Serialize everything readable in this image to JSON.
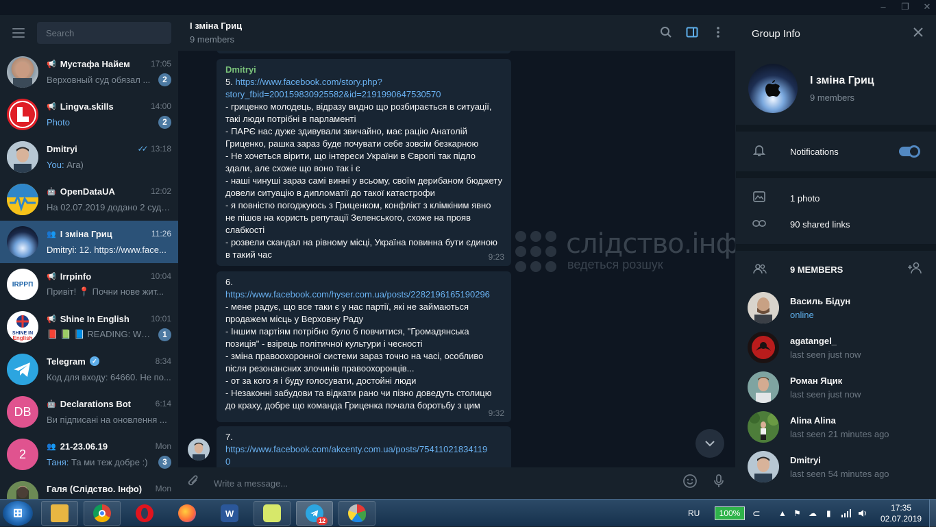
{
  "window": {
    "controls": [
      "–",
      "❐",
      "✕"
    ]
  },
  "sidebar": {
    "search_placeholder": "Search",
    "chats": [
      {
        "name": "Мустафа Найем",
        "time": "17:05",
        "preview": "Верховный суд обязал ...",
        "badge": "2",
        "type": "channel"
      },
      {
        "name": "Lingva.skills",
        "time": "14:00",
        "preview": "Photo",
        "badge": "2",
        "type": "channel"
      },
      {
        "name": "Dmitryi",
        "time": "13:18",
        "sender": "You:",
        "preview": "Ага)",
        "read": true
      },
      {
        "name": "OpenDataUA",
        "time": "12:02",
        "preview": "На 02.07.2019 додано 2 судо...",
        "type": "bot"
      },
      {
        "name": "І зміна Гриц",
        "time": "11:26",
        "sender": "Dmitryi:",
        "preview": "12. https://www.face...",
        "type": "group",
        "active": true
      },
      {
        "name": "Irrpinfo",
        "time": "10:04",
        "preview": "Привіт! 📍 Почни нове жит...",
        "type": "channel"
      },
      {
        "name": "Shine In English",
        "time": "10:01",
        "preview": "📕 📗 📘 READING: WO...",
        "badge": "1",
        "type": "channel"
      },
      {
        "name": "Telegram",
        "time": "8:34",
        "preview": "Код для входу: 64660. Не по...",
        "verified": true
      },
      {
        "name": "Declarations Bot",
        "time": "6:14",
        "preview": "Ви підписані на оновлення ...",
        "type": "bot",
        "initials": "DB"
      },
      {
        "name": "21-23.06.19",
        "time": "Mon",
        "sender": "Таня:",
        "preview": "Та ми теж добре :)",
        "badge": "3",
        "type": "group",
        "initials": "2"
      },
      {
        "name": "Галя (Слідство. Інфо)",
        "time": "Mon",
        "preview": ""
      }
    ]
  },
  "chat": {
    "title": "І зміна Гриц",
    "subtitle": "9 members",
    "messages": [
      {
        "author": "Dmitryi",
        "num": "5. ",
        "link": "https://www.facebook.com/story.php?story_fbid=2001598309255828id=2191990647530570",
        "link_display": "https://www.facebook.com/story.php?\nstory_fbid=200159830925582&id=2191990647530570",
        "text": "- гриценко молодець, відразу видно що розбирається в ситуації, такі люди потрібні в парламенті\n- ПАРЄ нас дуже здивували звичайно, має рацію Анатолій Гриценко, рашка зараз буде почувати себе зовсім безкарною\n- Не хочеться вірити, що інтереси України в Європі так підло здали, але схоже що воно так і є\n- наші чинуші зараз самі винні у всьому, своїм дерибаном бюджету довели ситуацію в дипломатії до такої катастрофи\n- я повністю погоджуюсь з Гриценком, конфлікт з клімкіним явно не пішов на користь репутації Зеленського, схоже на прояв слабкості\n- розвели скандал на рівному місці, Україна повинна бути єдиною в такий час",
        "time": "9:23"
      },
      {
        "num": "6.",
        "link": "https://www.facebook.com/hyser.com.ua/posts/2282196165190296",
        "text": "- мене радує, що все таки є у нас партії, які не займаються продажем місць у Верховну Раду\n- Іншим партіям потрібно було б повчитися, \"Громадянська позиція\" - взірець політичної культури і чесності\n- зміна правоохоронної системи зараз точно на часі, особливо після резонансних злочинів правоохоронців...\n- от за кого я і буду голосувати, достойні люди\n- Незаконні забудови та відкати рано чи пізно доведуть столицю до краху, добре що команда Гриценка почала боротьбу з цим",
        "time": "9:32"
      },
      {
        "num": "7.",
        "link": "https://www.facebook.com/akcenty.com.ua/posts/754110218341190",
        "link_display": "https://www.facebook.com/akcenty.com.ua/posts/75411021834119\n0"
      }
    ],
    "watermark": {
      "title": "слідство.інфо",
      "subtitle": "ведеться розшук"
    },
    "composer_placeholder": "Write a message..."
  },
  "info": {
    "title": "Group Info",
    "group_name": "І зміна Гриц",
    "group_sub": "9 members",
    "notifications_label": "Notifications",
    "notifications_on": true,
    "photos": "1 photo",
    "links": "90 shared links",
    "members_header": "9 MEMBERS",
    "members": [
      {
        "name": "Василь Бідун",
        "status": "online",
        "online": true
      },
      {
        "name": "agatangel_",
        "status": "last seen just now"
      },
      {
        "name": "Роман Яцик",
        "status": "last seen just now"
      },
      {
        "name": "Alina Alina",
        "status": "last seen 21 minutes ago"
      },
      {
        "name": "Dmitryi",
        "status": "last seen 54 minutes ago"
      }
    ]
  },
  "taskbar": {
    "lang": "RU",
    "battery": "100%",
    "time": "17:35",
    "date": "02.07.2019",
    "telegram_badge": "12"
  }
}
